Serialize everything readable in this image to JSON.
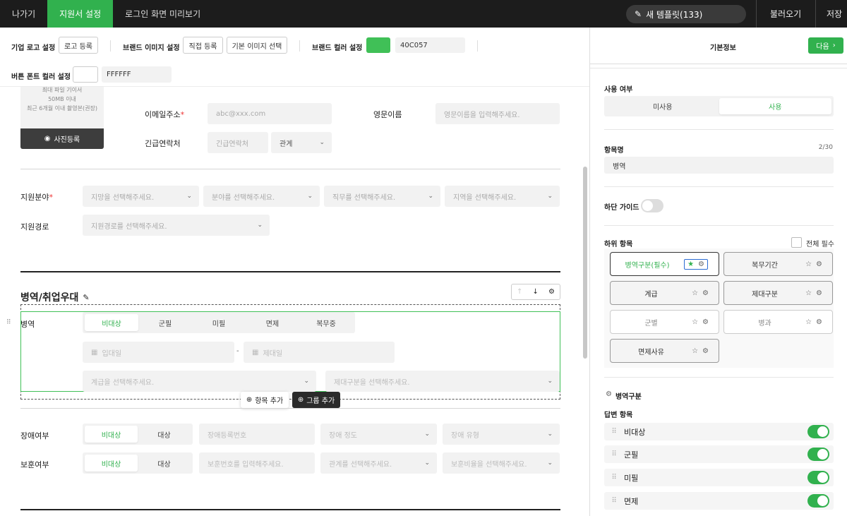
{
  "topbar": {
    "exit": "나가기",
    "settings": "지원서 설정",
    "preview": "로그인 화면 미리보기",
    "template": "새 템플릿(133)",
    "load": "불러오기",
    "save": "저장"
  },
  "options": {
    "logo_label": "기업 로고 설정",
    "logo_btn": "로고 등록",
    "brand_label": "브랜드 이미지 설정",
    "direct_btn": "직접 등록",
    "default_btn": "기본 이미지 선택",
    "color_label": "브랜드 컬러 설정",
    "color_hex": "40C057",
    "font_label": "버튼 폰트 컬러 설정",
    "font_hex": "FFFFFF",
    "brand_color": "#40C057"
  },
  "photo": {
    "line1": "최대 파일 기이서",
    "line2": "50MB 이내",
    "line3": "최근 6개월 이내 촬영본(권장)",
    "btn": "사진등록"
  },
  "form": {
    "email_label": "이메일주소",
    "email_ph": "abc@xxx.com",
    "eng_label": "영문이름",
    "eng_ph": "영문이름을 입력해주세요.",
    "emergency_label": "긴급연락처",
    "emergency_ph": "긴급연락처",
    "relation": "관계",
    "field_label": "지원분야",
    "field_hope": "지망을 선택해주세요.",
    "field_area": "분야를 선택해주세요.",
    "field_job": "직무를 선택해주세요.",
    "field_region": "지역을 선택해주세요.",
    "route_label": "지원경로",
    "route_ph": "지원경로를 선택해주세요.",
    "military_section": "병역/취업우대",
    "military_label": "병역",
    "military_tabs": [
      "비대상",
      "군필",
      "미필",
      "면제",
      "복무중"
    ],
    "enlist_ph": "입대일",
    "discharge_ph": "제대일",
    "range_sep": "-",
    "rank_ph": "계급을 선택해주세요.",
    "discharge_type_ph": "제대구분을 선택해주세요.",
    "add_item": "항목 추가",
    "add_group": "그룹 추가",
    "disability_label": "장애여부",
    "disability_tabs": [
      "비대상",
      "대상"
    ],
    "disability_no_ph": "장애등록번호",
    "disability_level_ph": "장애 정도",
    "disability_type_ph": "장애 유형",
    "veteran_label": "보훈여부",
    "veteran_tabs": [
      "비대상",
      "대상"
    ],
    "veteran_no_ph": "보훈번호를 입력해주세요.",
    "veteran_rel_ph": "관계를 선택해주세요.",
    "veteran_ratio_ph": "보훈비율을 선택해주세요."
  },
  "panel": {
    "title": "기본정보",
    "next": "다음",
    "usage_label": "사용 여부",
    "usage_tabs": [
      "미사용",
      "사용"
    ],
    "name_label": "항목명",
    "name_count": "2/30",
    "name_value": "병역",
    "guide_label": "하단 가이드",
    "sub_label": "하위 항목",
    "all_required": "전체 필수",
    "chips": [
      "병역구분(필수)",
      "복무기간",
      "계급",
      "제대구분",
      "군별",
      "병과",
      "면제사유"
    ],
    "group_title": "병역구분",
    "answer_label": "답변 항목",
    "answers": [
      "비대상",
      "군필",
      "미필",
      "면제"
    ]
  }
}
